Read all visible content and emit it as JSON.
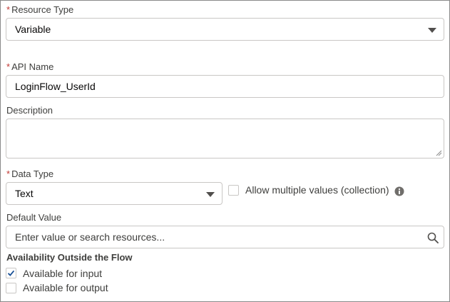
{
  "resource_type": {
    "required_marker": "*",
    "label": "Resource Type",
    "value": "Variable"
  },
  "api_name": {
    "required_marker": "*",
    "label": "API Name",
    "value": "LoginFlow_UserId"
  },
  "description": {
    "label": "Description",
    "value": ""
  },
  "data_type": {
    "required_marker": "*",
    "label": "Data Type",
    "value": "Text",
    "allow_multiple_label": "Allow multiple values (collection)",
    "allow_multiple_checked": false
  },
  "default_value": {
    "label": "Default Value",
    "placeholder": "Enter value or search resources..."
  },
  "availability": {
    "heading": "Availability Outside the Flow",
    "input_label": "Available for input",
    "input_checked": true,
    "output_label": "Available for output",
    "output_checked": false
  },
  "colors": {
    "required": "#c23934",
    "border": "#c9c7c5",
    "check": "#1b5297",
    "info_icon": "#706e6b"
  }
}
